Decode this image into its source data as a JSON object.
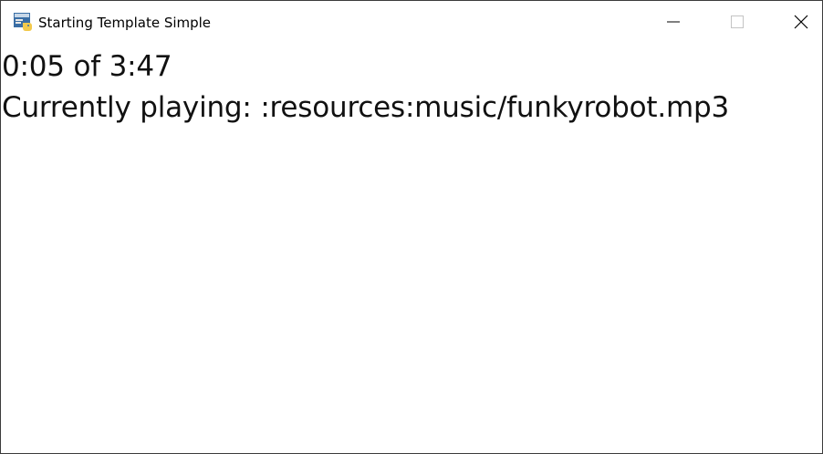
{
  "window": {
    "title": "Starting Template Simple",
    "icon": "python-app-icon",
    "controls": {
      "minimize": "minimize-icon",
      "maximize": "maximize-icon",
      "close": "close-icon"
    }
  },
  "player": {
    "progress_text": "0:05 of 3:47",
    "now_playing_text": "Currently playing: :resources:music/funkyrobot.mp3"
  }
}
